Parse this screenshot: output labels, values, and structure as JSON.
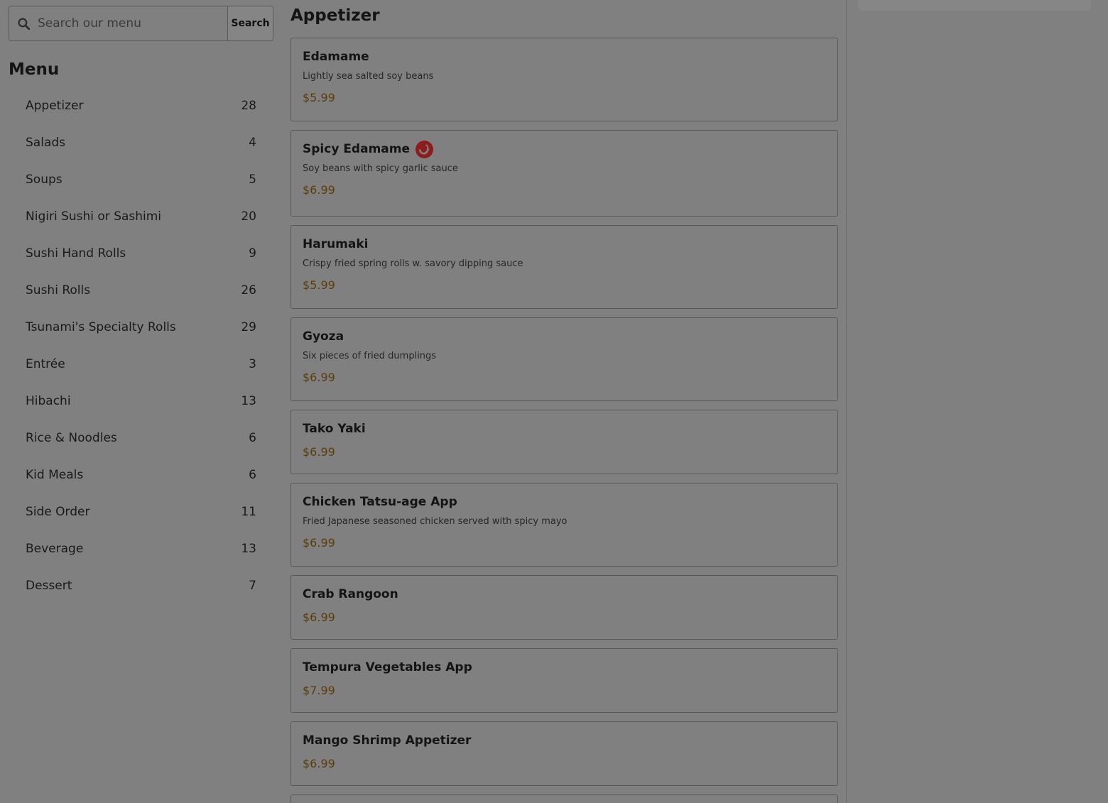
{
  "search": {
    "placeholder": "Search our menu",
    "button_label": "Search"
  },
  "sidebar": {
    "title": "Menu",
    "categories": [
      {
        "label": "Appetizer",
        "count": "28"
      },
      {
        "label": "Salads",
        "count": "4"
      },
      {
        "label": "Soups",
        "count": "5"
      },
      {
        "label": "Nigiri Sushi or Sashimi",
        "count": "20"
      },
      {
        "label": "Sushi Hand Rolls",
        "count": "9"
      },
      {
        "label": "Sushi Rolls",
        "count": "26"
      },
      {
        "label": "Tsunami's Specialty Rolls",
        "count": "29"
      },
      {
        "label": "Entrée",
        "count": "3"
      },
      {
        "label": "Hibachi",
        "count": "13"
      },
      {
        "label": "Rice & Noodles",
        "count": "6"
      },
      {
        "label": "Kid Meals",
        "count": "6"
      },
      {
        "label": "Side Order",
        "count": "11"
      },
      {
        "label": "Beverage",
        "count": "13"
      },
      {
        "label": "Dessert",
        "count": "7"
      }
    ]
  },
  "section": {
    "title": "Appetizer",
    "items": [
      {
        "name": "Edamame",
        "description": "Lightly sea salted soy beans",
        "price": "$5.99"
      },
      {
        "name": "Spicy Edamame",
        "description": "Soy beans with spicy garlic sauce",
        "price": "$6.99",
        "icon": "spicy-pepper-icon"
      },
      {
        "name": "Harumaki",
        "description": "Crispy fried spring rolls w. savory dipping sauce",
        "price": "$5.99"
      },
      {
        "name": "Gyoza",
        "description": "Six pieces of fried dumplings",
        "price": "$6.99"
      },
      {
        "name": "Tako Yaki",
        "price": "$6.99"
      },
      {
        "name": "Chicken Tatsu-age App",
        "description": "Fried Japanese seasoned chicken served with spicy mayo",
        "price": "$6.99"
      },
      {
        "name": "Crab Rangoon",
        "price": "$6.99"
      },
      {
        "name": "Tempura Vegetables App",
        "price": "$7.99"
      },
      {
        "name": "Mango Shrimp Appetizer",
        "price": "$6.99"
      }
    ]
  },
  "colors": {
    "overlay_background": "#808080",
    "price_text": "#5c3d0a",
    "spicy_icon": "#8b1d1d"
  }
}
